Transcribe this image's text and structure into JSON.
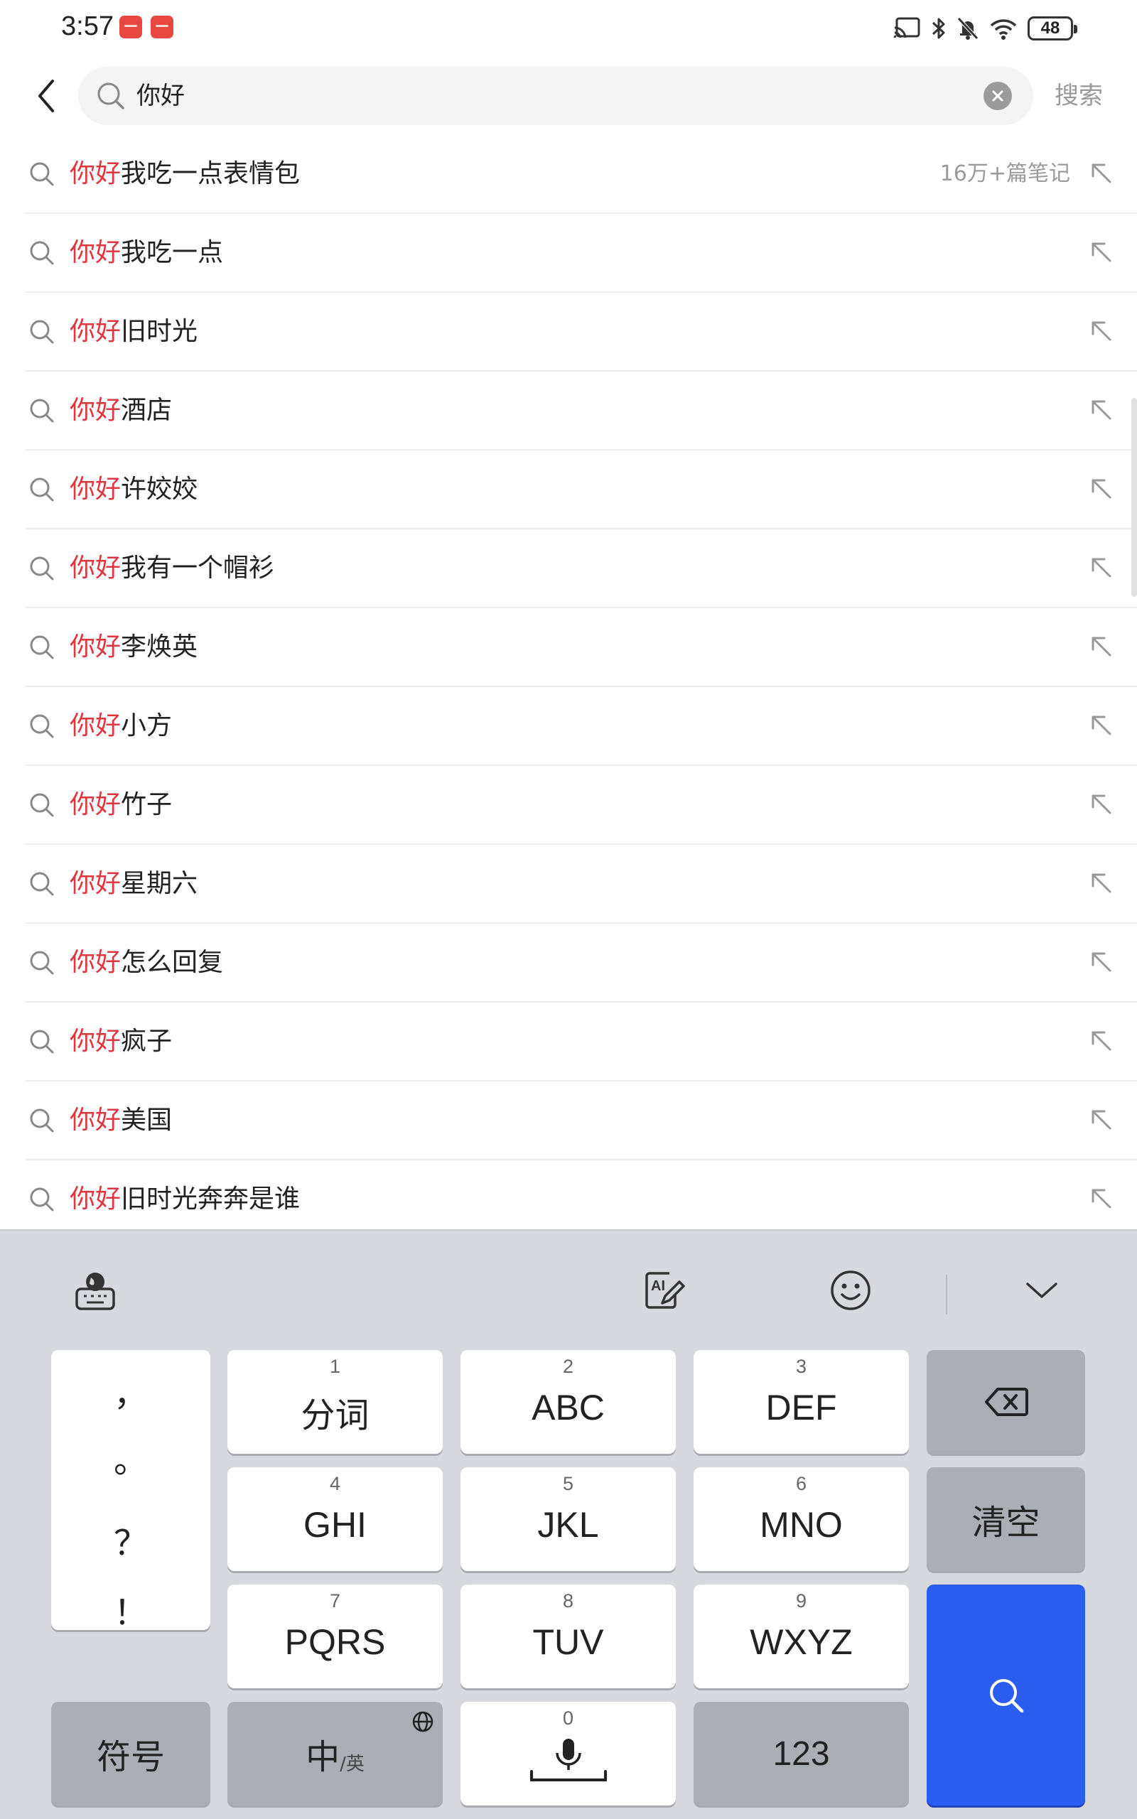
{
  "status_bar": {
    "time": "3:57",
    "battery": "48"
  },
  "search": {
    "query": "你好",
    "search_button_label": "搜索"
  },
  "suggestions": [
    {
      "highlight": "你好",
      "rest": "我吃一点表情包",
      "meta": "16万+篇笔记"
    },
    {
      "highlight": "你好",
      "rest": "我吃一点",
      "meta": ""
    },
    {
      "highlight": "你好",
      "rest": "旧时光",
      "meta": ""
    },
    {
      "highlight": "你好",
      "rest": "酒店",
      "meta": ""
    },
    {
      "highlight": "你好",
      "rest": "许姣姣",
      "meta": ""
    },
    {
      "highlight": "你好",
      "rest": "我有一个帽衫",
      "meta": ""
    },
    {
      "highlight": "你好",
      "rest": "李焕英",
      "meta": ""
    },
    {
      "highlight": "你好",
      "rest": "小方",
      "meta": ""
    },
    {
      "highlight": "你好",
      "rest": "竹子",
      "meta": ""
    },
    {
      "highlight": "你好",
      "rest": "星期六",
      "meta": ""
    },
    {
      "highlight": "你好",
      "rest": "怎么回复",
      "meta": ""
    },
    {
      "highlight": "你好",
      "rest": "疯子",
      "meta": ""
    },
    {
      "highlight": "你好",
      "rest": "美国",
      "meta": ""
    },
    {
      "highlight": "你好",
      "rest": "旧时光奔奔是谁",
      "meta": ""
    }
  ],
  "keyboard": {
    "punctuation": [
      "，",
      "。",
      "？",
      "！"
    ],
    "keys": {
      "k1": {
        "num": "1",
        "label": "分词"
      },
      "k2": {
        "num": "2",
        "label": "ABC"
      },
      "k3": {
        "num": "3",
        "label": "DEF"
      },
      "k4": {
        "num": "4",
        "label": "GHI"
      },
      "k5": {
        "num": "5",
        "label": "JKL"
      },
      "k6": {
        "num": "6",
        "label": "MNO"
      },
      "k7": {
        "num": "7",
        "label": "PQRS"
      },
      "k8": {
        "num": "8",
        "label": "TUV"
      },
      "k9": {
        "num": "9",
        "label": "WXYZ"
      },
      "k0": {
        "num": "0"
      }
    },
    "clear_label": "清空",
    "symbol_label": "符号",
    "lang_main": "中",
    "lang_sub": "/英",
    "numeric_label": "123"
  },
  "colors": {
    "highlight": "#e0363f",
    "accent_key": "#2b5ef0",
    "keyboard_bg": "#d8d9de"
  }
}
